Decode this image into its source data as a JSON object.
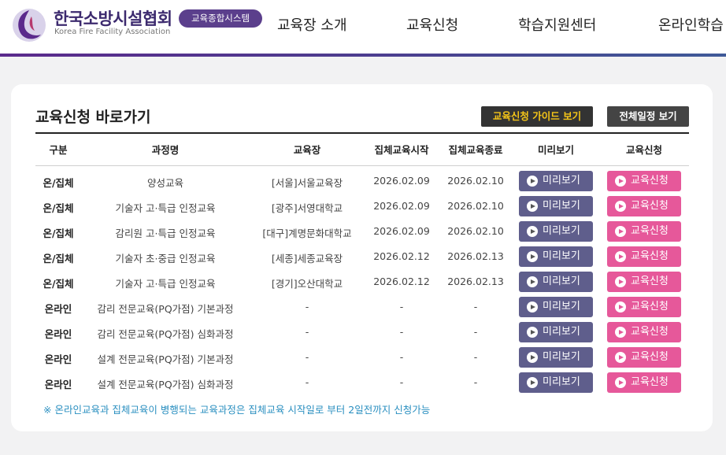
{
  "header": {
    "org_name": "한국소방시설협회",
    "org_sub": "Korea Fire Facility Association",
    "system_badge": "교육종합시스템",
    "nav": [
      "교육장 소개",
      "교육신청",
      "학습지원센터",
      "온라인학습"
    ]
  },
  "card": {
    "title": "교육신청 바로가기",
    "guide_button": "교육신청 가이드 보기",
    "schedule_button": "전체일정 보기",
    "columns": [
      "구분",
      "과정명",
      "교육장",
      "집체교육시작",
      "집체교육종료",
      "미리보기",
      "교육신청"
    ],
    "rows": [
      {
        "type": "온/집체",
        "course": "양성교육",
        "venue": "[서울]서울교육장",
        "start": "2026.02.09",
        "end": "2026.02.10"
      },
      {
        "type": "온/집체",
        "course": "기술자 고·특급 인정교육",
        "venue": "[광주]서영대학교",
        "start": "2026.02.09",
        "end": "2026.02.10"
      },
      {
        "type": "온/집체",
        "course": "감리원 고·특급 인정교육",
        "venue": "[대구]계명문화대학교",
        "start": "2026.02.09",
        "end": "2026.02.10"
      },
      {
        "type": "온/집체",
        "course": "기술자 초·중급 인정교육",
        "venue": "[세종]세종교육장",
        "start": "2026.02.12",
        "end": "2026.02.13"
      },
      {
        "type": "온/집체",
        "course": "기술자 고·특급 인정교육",
        "venue": "[경기]오산대학교",
        "start": "2026.02.12",
        "end": "2026.02.13"
      },
      {
        "type": "온라인",
        "course": "감리 전문교육(PQ가점) 기본과정",
        "venue": "-",
        "start": "-",
        "end": "-"
      },
      {
        "type": "온라인",
        "course": "감리 전문교육(PQ가점) 심화과정",
        "venue": "-",
        "start": "-",
        "end": "-"
      },
      {
        "type": "온라인",
        "course": "설계 전문교육(PQ가점) 기본과정",
        "venue": "-",
        "start": "-",
        "end": "-"
      },
      {
        "type": "온라인",
        "course": "설계 전문교육(PQ가점) 심화과정",
        "venue": "-",
        "start": "-",
        "end": "-"
      }
    ],
    "preview_label": "미리보기",
    "apply_label": "교육신청",
    "note": "※ 온라인교육과 집체교육이 병행되는 교육과정은 집체교육 시작일로 부터 2일전까지 신청가능"
  },
  "colors": {
    "brand": "#5b3f8c",
    "preview": "#5f5e8c",
    "apply": "#e6589a",
    "guide_text": "#f5c518",
    "note": "#2a8fc0"
  },
  "icons": {
    "logo": "kfa-logo",
    "button_icon": "play-circle-icon"
  }
}
